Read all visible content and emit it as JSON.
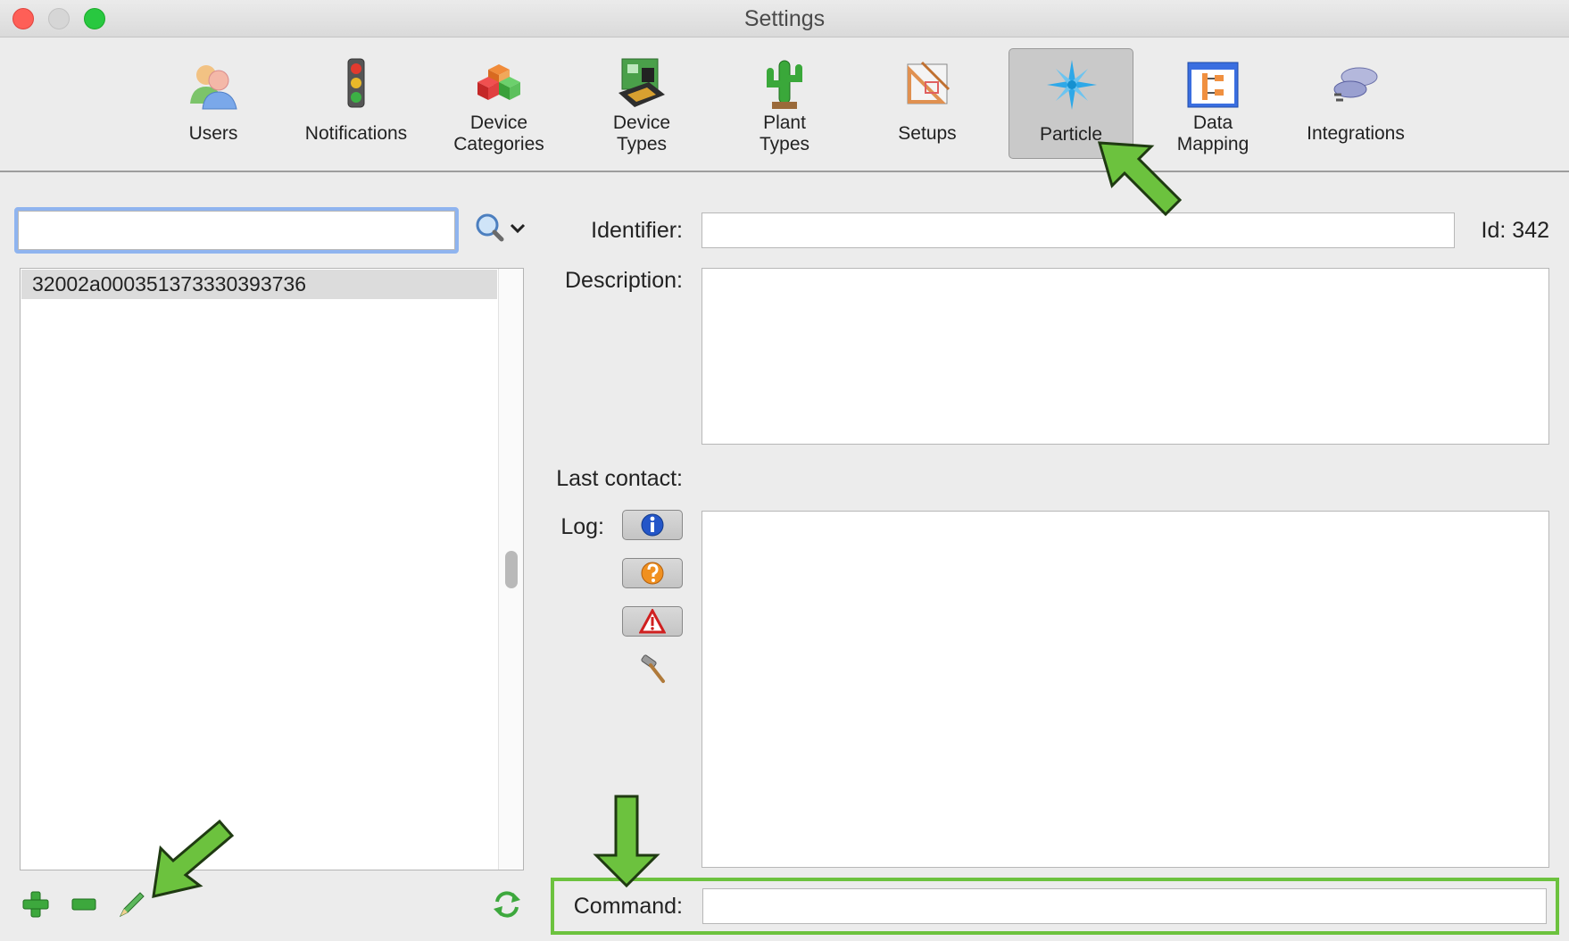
{
  "window": {
    "title": "Settings"
  },
  "toolbar": {
    "items": [
      {
        "label": "Users",
        "icon": "users-icon"
      },
      {
        "label": "Notifications",
        "icon": "traffic-light-icon"
      },
      {
        "label": "Device\nCategories",
        "icon": "cubes-icon"
      },
      {
        "label": "Device\nTypes",
        "icon": "circuit-board-icon"
      },
      {
        "label": "Plant\nTypes",
        "icon": "cactus-icon"
      },
      {
        "label": "Setups",
        "icon": "drafting-tools-icon"
      },
      {
        "label": "Particle",
        "icon": "particle-star-icon",
        "selected": true
      },
      {
        "label": "Data\nMapping",
        "icon": "data-mapping-icon"
      },
      {
        "label": "Integrations",
        "icon": "integrations-plug-icon"
      }
    ]
  },
  "search": {
    "value": "",
    "placeholder": ""
  },
  "list": {
    "items": [
      {
        "label": "32002a000351373330393736",
        "selected": true
      }
    ]
  },
  "form": {
    "identifier_label": "Identifier:",
    "identifier_value": "",
    "id_label": "Id: 342",
    "description_label": "Description:",
    "description_value": "",
    "last_contact_label": "Last contact:",
    "last_contact_value": "",
    "log_label": "Log:",
    "log_value": "",
    "command_label": "Command:",
    "command_value": ""
  },
  "log_filters": [
    {
      "icon": "info-icon"
    },
    {
      "icon": "question-icon"
    },
    {
      "icon": "warning-icon"
    },
    {
      "icon": "hammer-icon"
    }
  ],
  "colors": {
    "selected_tab": "#c9c9c9",
    "highlight": "#6cc23e",
    "search_focus": "#8fb4ef"
  }
}
